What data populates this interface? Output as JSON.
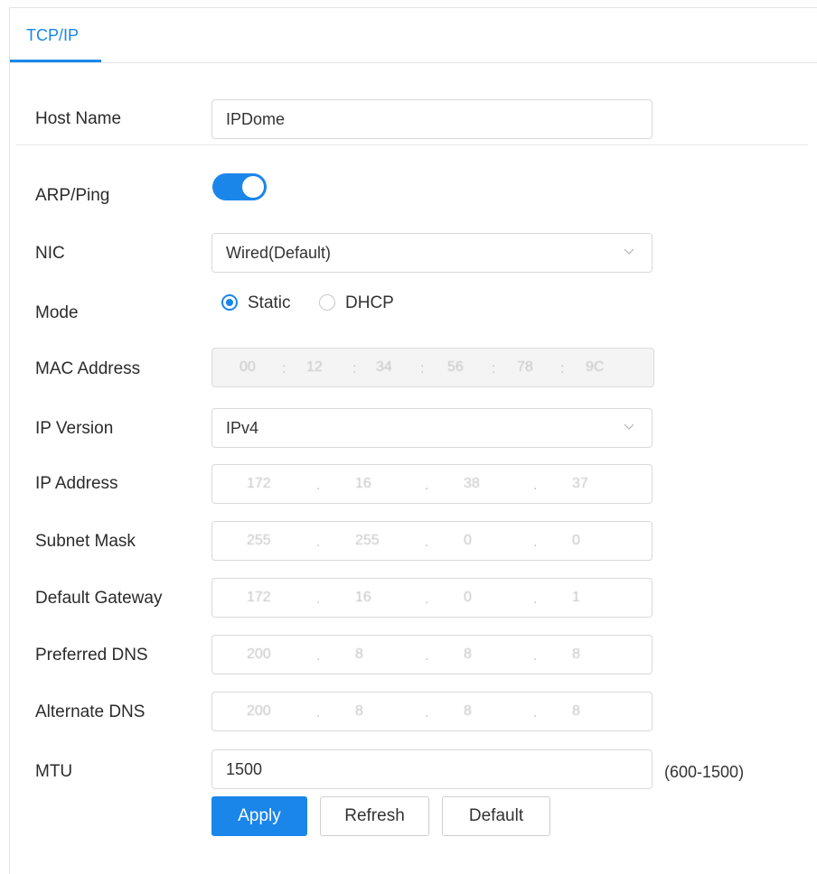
{
  "tabs": [
    {
      "label": "TCP/IP",
      "active": true
    }
  ],
  "form": {
    "host_name": {
      "label": "Host Name",
      "value": "IPDome"
    },
    "arp_ping": {
      "label": "ARP/Ping",
      "enabled": true
    },
    "nic": {
      "label": "NIC",
      "value": "Wired(Default)"
    },
    "mode": {
      "label": "Mode",
      "options": [
        "Static",
        "DHCP"
      ],
      "selected": "Static"
    },
    "mac_address": {
      "label": "MAC Address",
      "segments": [
        "00",
        "12",
        "34",
        "56",
        "78",
        "9C"
      ],
      "separator": ":"
    },
    "ip_version": {
      "label": "IP Version",
      "value": "IPv4"
    },
    "ip_address": {
      "label": "IP Address",
      "octets": [
        "172",
        "16",
        "38",
        "37"
      ]
    },
    "subnet_mask": {
      "label": "Subnet Mask",
      "octets": [
        "255",
        "255",
        "0",
        "0"
      ]
    },
    "default_gateway": {
      "label": "Default Gateway",
      "octets": [
        "172",
        "16",
        "0",
        "1"
      ]
    },
    "preferred_dns": {
      "label": "Preferred DNS",
      "octets": [
        "200",
        "8",
        "8",
        "8"
      ]
    },
    "alternate_dns": {
      "label": "Alternate DNS",
      "octets": [
        "200",
        "8",
        "8",
        "8"
      ]
    },
    "mtu": {
      "label": "MTU",
      "value": "1500",
      "range_hint": "(600-1500)"
    }
  },
  "buttons": {
    "apply": "Apply",
    "refresh": "Refresh",
    "default": "Default"
  },
  "colors": {
    "accent": "#1a86ea",
    "border": "#d9d9d9",
    "disabled_bg": "#f4f4f4"
  },
  "icons": {
    "dropdown": "chevron-down-icon"
  }
}
